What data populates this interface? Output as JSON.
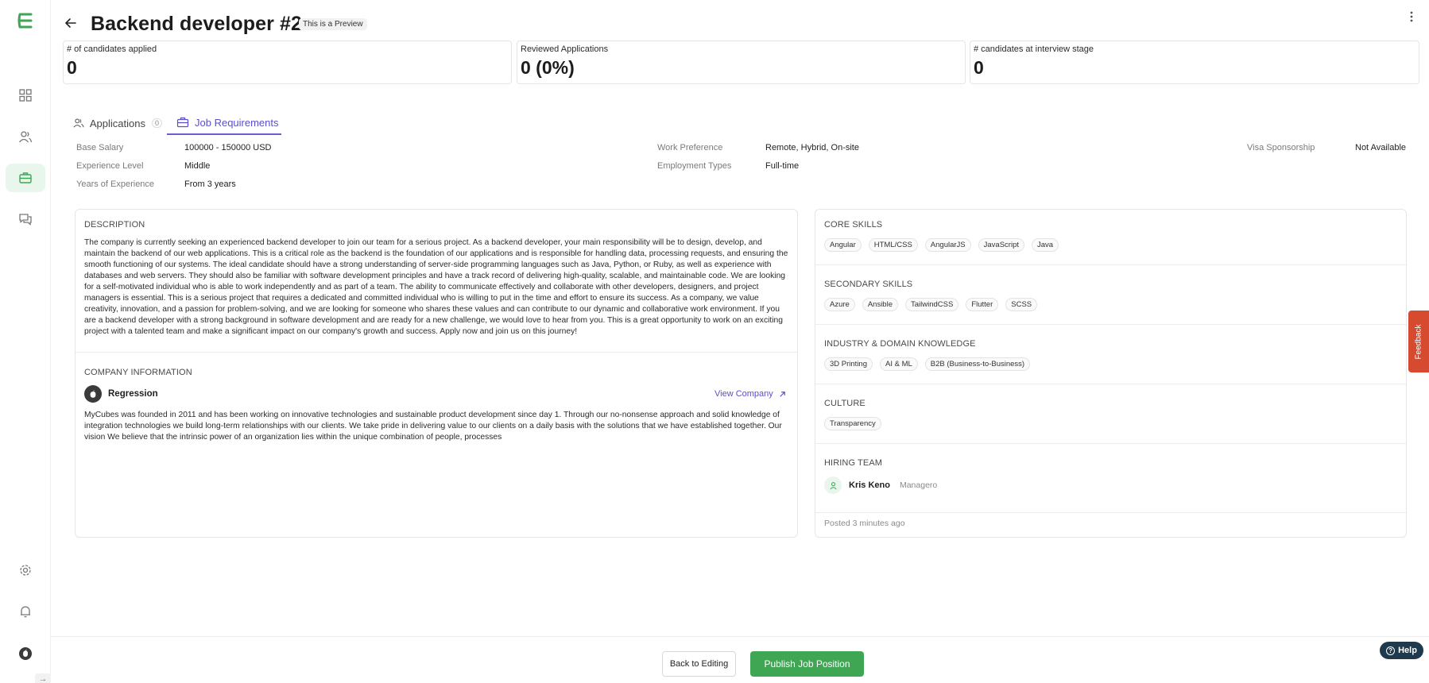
{
  "header": {
    "title": "Backend developer #2",
    "preview_badge": "This is a Preview"
  },
  "stats": [
    {
      "label": "# of candidates applied",
      "value": "0"
    },
    {
      "label": "Reviewed Applications",
      "value": "0 (0%)"
    },
    {
      "label": "# candidates at interview stage",
      "value": "0"
    }
  ],
  "tabs": [
    {
      "label": "Applications",
      "count": "0"
    },
    {
      "label": "Job Requirements"
    }
  ],
  "requirements": {
    "base_salary_label": "Base Salary",
    "base_salary": "100000 - 150000 USD",
    "experience_level_label": "Experience Level",
    "experience_level": "Middle",
    "years_label": "Years of Experience",
    "years": "From 3 years",
    "work_pref_label": "Work Preference",
    "work_pref": "Remote, Hybrid, On-site",
    "employment_label": "Employment Types",
    "employment": "Full-time",
    "visa_label": "Visa Sponsorship",
    "visa": "Not Available"
  },
  "description": {
    "title": "DESCRIPTION",
    "text": "The company is currently seeking an experienced backend developer to join our team for a serious project. As a backend developer, your main responsibility will be to design, develop, and maintain the backend of our web applications. This is a critical role as the backend is the foundation of our applications and is responsible for handling data, processing requests, and ensuring the smooth functioning of our systems. The ideal candidate should have a strong understanding of server-side programming languages such as Java, Python, or Ruby, as well as experience with databases and web servers. They should also be familiar with software development principles and have a track record of delivering high-quality, scalable, and maintainable code. We are looking for a self-motivated individual who is able to work independently and as part of a team. The ability to communicate effectively and collaborate with other developers, designers, and project managers is essential. This is a serious project that requires a dedicated and committed individual who is willing to put in the time and effort to ensure its success. As a company, we value creativity, innovation, and a passion for problem-solving, and we are looking for someone who shares these values and can contribute to our dynamic and collaborative work environment. If you are a backend developer with a strong background in software development and are ready for a new challenge, we would love to hear from you. This is a great opportunity to work on an exciting project with a talented team and make a significant impact on our company's growth and success. Apply now and join us on this journey!"
  },
  "company": {
    "title": "COMPANY INFORMATION",
    "name": "Regression",
    "view_link": "View Company",
    "about": "MyCubes was founded in 2011 and has been working on innovative technologies and sustainable product development since day 1. Through our no-nonsense approach and solid knowledge of integration technologies we build long-term relationships with our clients. We take pride in delivering value to our clients on a daily basis with the solutions that we have established together. Our vision We believe that the intrinsic power of an organization lies within the unique combination of people, processes"
  },
  "skills": {
    "core_title": "CORE SKILLS",
    "core": [
      "Angular",
      "HTML/CSS",
      "AngularJS",
      "JavaScript",
      "Java"
    ],
    "secondary_title": "SECONDARY SKILLS",
    "secondary": [
      "Azure",
      "Ansible",
      "TailwindCSS",
      "Flutter",
      "SCSS"
    ],
    "industry_title": "INDUSTRY & DOMAIN KNOWLEDGE",
    "industry": [
      "3D Printing",
      "AI & ML",
      "B2B (Business-to-Business)"
    ],
    "culture_title": "CULTURE",
    "culture": [
      "Transparency"
    ]
  },
  "hiring": {
    "title": "HIRING TEAM",
    "member_name": "Kris Keno",
    "member_role": "Managero",
    "posted": "Posted 3 minutes ago"
  },
  "footer": {
    "back_label": "Back to Editing",
    "publish_label": "Publish Job Position",
    "help_label": "Help",
    "feedback_label": "Feedback"
  },
  "colors": {
    "brand_green": "#3fa653",
    "accent_purple": "#5b4fc9",
    "feedback_red": "#d64a2f",
    "help_navy": "#1f3a4d"
  }
}
